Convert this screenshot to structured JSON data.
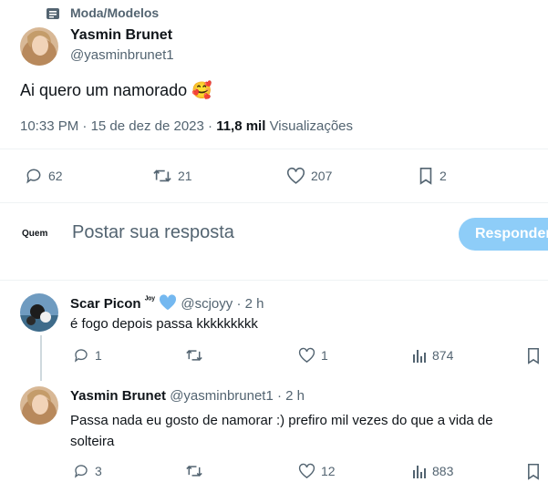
{
  "context": {
    "icon": "community-icon",
    "label": "Moda/Modelos"
  },
  "post": {
    "author_name": "Yasmin Brunet",
    "author_handle": "@yasminbrunet1",
    "text": "Ai quero um namorado",
    "emoji": "🥰",
    "time": "10:33 PM",
    "dot": " · ",
    "date": "15 de dez de 2023",
    "views_count": "11,8 mil",
    "views_label": "Visualizações",
    "stats": {
      "replies": "62",
      "retweets": "21",
      "likes": "207",
      "bookmarks": "2"
    }
  },
  "composer": {
    "avatar_text": "Quem",
    "placeholder": "Postar sua resposta",
    "button": "Responder"
  },
  "replies": [
    {
      "name": "Scar Picon",
      "name_suffix": "ᴶᵒʸ",
      "handle": "@scjoyy",
      "time": "· 2 h",
      "text": "é fogo depois passa kkkkkkkkk",
      "replies": "1",
      "retweets": "",
      "likes": "1",
      "views": "874"
    },
    {
      "name": "Yasmin Brunet",
      "handle": "@yasminbrunet1",
      "time": "· 2 h",
      "text_line1": "Passa nada eu gosto de namorar :) prefiro mil vezes do que a vida de",
      "text_line2": "solteira",
      "replies": "3",
      "retweets": "",
      "likes": "12",
      "views": "883"
    }
  ],
  "colors": {
    "accent": "#1d9bf0",
    "button_disabled": "#8ecdf8",
    "muted": "#536471",
    "heart_blue": "#74b8f0"
  }
}
